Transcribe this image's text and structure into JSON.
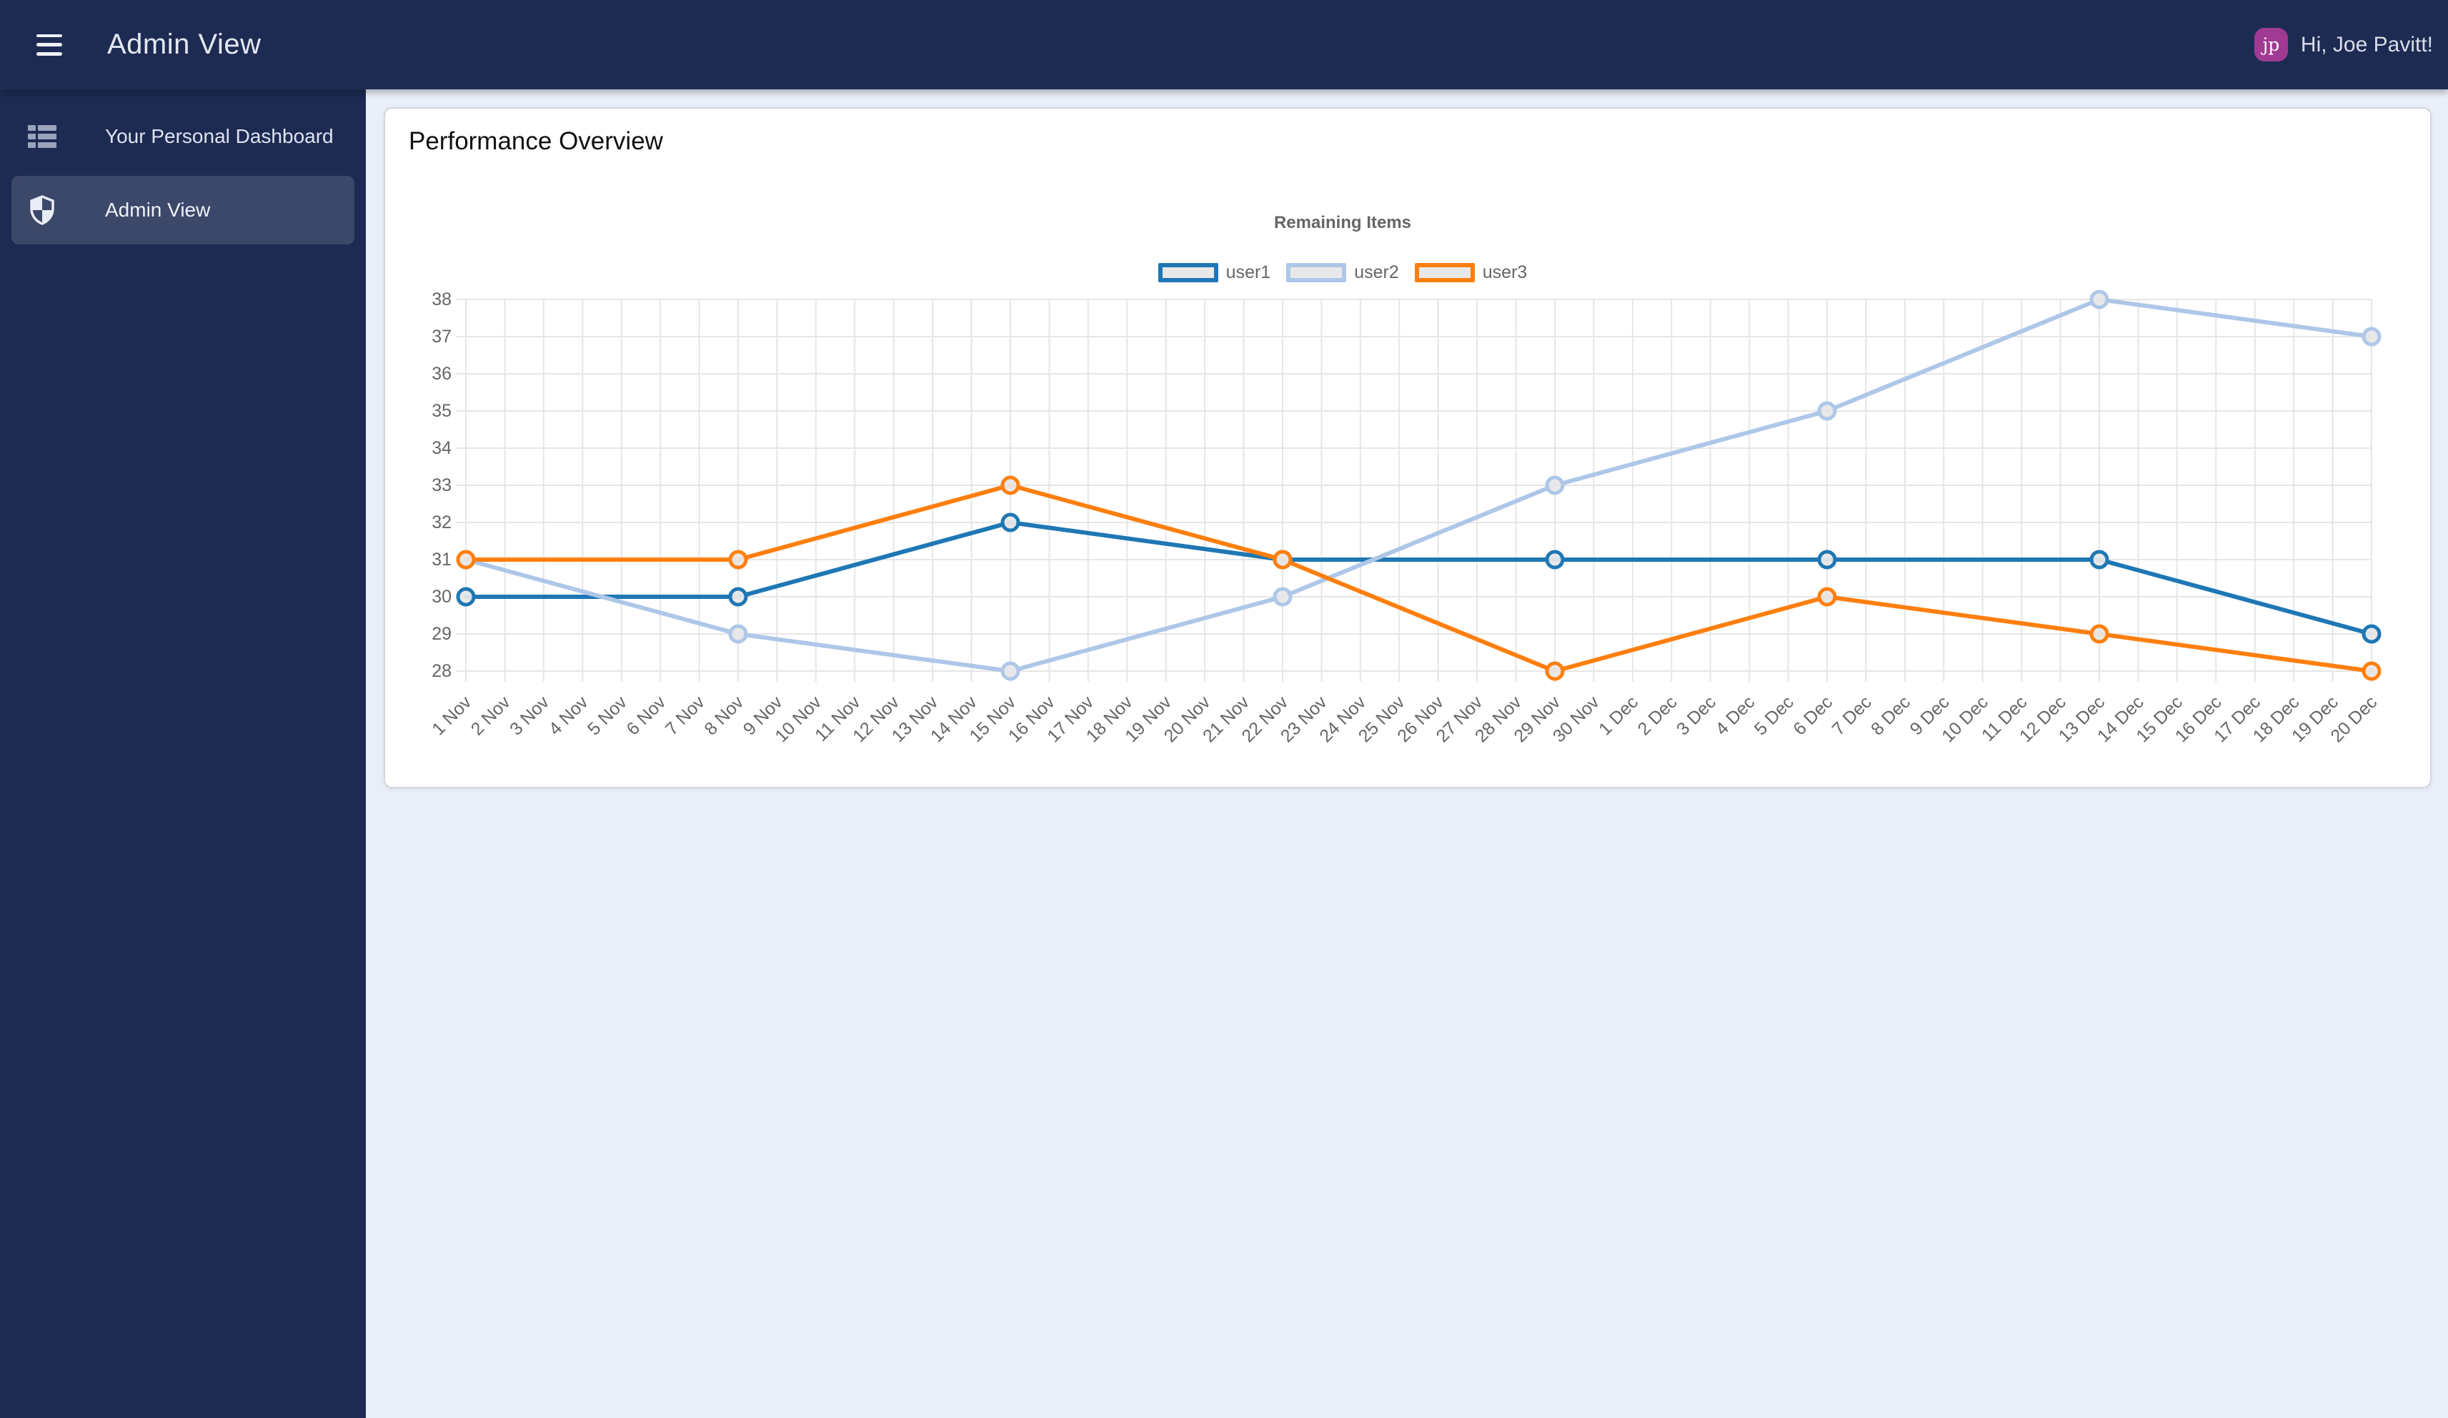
{
  "navbar": {
    "title": "Admin View",
    "greeting": "Hi, Joe Pavitt!",
    "avatar_initials": "jp",
    "avatar_color": "#a03a93",
    "bg_color": "#1d2b53"
  },
  "sidebar": {
    "items": [
      {
        "label": "Your Personal Dashboard",
        "icon": "dashboard-grid-icon",
        "active": false
      },
      {
        "label": "Admin View",
        "icon": "shield-icon",
        "active": true
      }
    ]
  },
  "main": {
    "card_title": "Performance Overview"
  },
  "chart_data": {
    "type": "line",
    "title": "Remaining Items",
    "legend_position": "top",
    "grid": true,
    "xlabel": "",
    "ylabel": "",
    "ylim": [
      28,
      38
    ],
    "ytick_step": 1,
    "categories": [
      "1 Nov",
      "2 Nov",
      "3 Nov",
      "4 Nov",
      "5 Nov",
      "6 Nov",
      "7 Nov",
      "8 Nov",
      "9 Nov",
      "10 Nov",
      "11 Nov",
      "12 Nov",
      "13 Nov",
      "14 Nov",
      "15 Nov",
      "16 Nov",
      "17 Nov",
      "18 Nov",
      "19 Nov",
      "20 Nov",
      "21 Nov",
      "22 Nov",
      "23 Nov",
      "24 Nov",
      "25 Nov",
      "26 Nov",
      "27 Nov",
      "28 Nov",
      "29 Nov",
      "30 Nov",
      "1 Dec",
      "2 Dec",
      "3 Dec",
      "4 Dec",
      "5 Dec",
      "6 Dec",
      "7 Dec",
      "8 Dec",
      "9 Dec",
      "10 Dec",
      "11 Dec",
      "12 Dec",
      "13 Dec",
      "14 Dec",
      "15 Dec",
      "16 Dec",
      "17 Dec",
      "18 Dec",
      "19 Dec",
      "20 Dec"
    ],
    "point_indices": [
      0,
      7,
      14,
      21,
      28,
      35,
      42,
      49
    ],
    "series": [
      {
        "name": "user1",
        "color": "#1f77b4",
        "values": [
          30,
          30,
          32,
          31,
          31,
          31,
          31,
          29
        ]
      },
      {
        "name": "user2",
        "color": "#aec7e8",
        "values": [
          31,
          29,
          28,
          30,
          33,
          35,
          38,
          37
        ]
      },
      {
        "name": "user3",
        "color": "#ff7f0e",
        "values": [
          31,
          31,
          33,
          31,
          28,
          30,
          29,
          28
        ]
      }
    ],
    "point_fill": "#e8e8e8",
    "grid_color": "#e6e6e6",
    "tick_text_color": "#666666"
  }
}
